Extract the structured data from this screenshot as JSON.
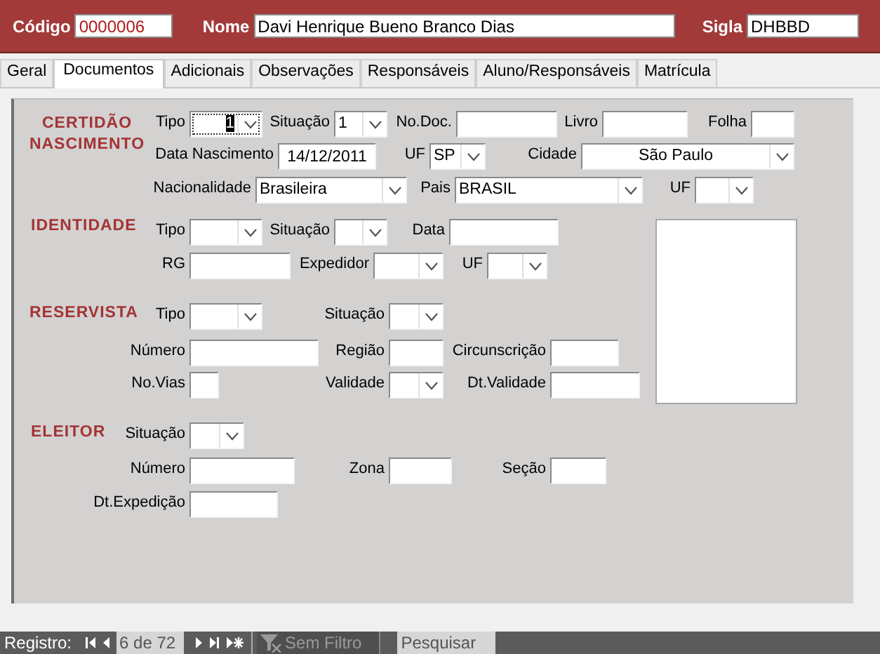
{
  "header": {
    "fields": [
      {
        "label": "Código",
        "value": "0000006"
      },
      {
        "label": "Nome",
        "value": "Davi Henrique Bueno Branco Dias"
      },
      {
        "label": "Sigla",
        "value": "DHBBD"
      }
    ]
  },
  "tabs": [
    {
      "label": "Geral",
      "selected": false
    },
    {
      "label": "Documentos",
      "selected": true
    },
    {
      "label": "Adicionais",
      "selected": false
    },
    {
      "label": "Observações",
      "selected": false
    },
    {
      "label": "Responsáveis",
      "selected": false
    },
    {
      "label": "Aluno/Responsáveis",
      "selected": false
    },
    {
      "label": "Matrícula",
      "selected": false
    }
  ],
  "sections": [
    {
      "title": "CERTIDÃO NASCIMENTO",
      "fields": [
        {
          "label": "Tipo",
          "kind": "combo",
          "value": "1",
          "focused": true
        },
        {
          "label": "Situação",
          "kind": "combo",
          "value": "1",
          "focused": false
        },
        {
          "label": "No.Doc.",
          "kind": "text",
          "focused": false
        },
        {
          "label": "Livro",
          "kind": "text",
          "focused": false
        },
        {
          "label": "Folha",
          "kind": "text",
          "focused": false
        },
        {
          "label": "Data Nascimento",
          "kind": "text",
          "value": "14/12/2011",
          "focused": false
        },
        {
          "label": "UF",
          "kind": "combo",
          "value": "SP",
          "focused": false
        },
        {
          "label": "Cidade",
          "kind": "combo",
          "value": "São Paulo",
          "focused": false
        },
        {
          "label": "Nacionalidade",
          "kind": "combo",
          "value": "Brasileira",
          "focused": false
        },
        {
          "label": "Pais",
          "kind": "combo",
          "value": "BRASIL",
          "focused": false
        },
        {
          "label": "UF",
          "kind": "combo",
          "focused": false
        }
      ]
    },
    {
      "title": "IDENTIDADE",
      "fields": [
        {
          "label": "Tipo",
          "kind": "combo",
          "focused": false
        },
        {
          "label": "Situação",
          "kind": "combo",
          "focused": false
        },
        {
          "label": "Data",
          "kind": "text",
          "focused": false
        },
        {
          "label": "RG",
          "kind": "text",
          "focused": false
        },
        {
          "label": "Expedidor",
          "kind": "combo",
          "focused": false
        },
        {
          "label": "UF",
          "kind": "combo",
          "focused": false
        }
      ]
    },
    {
      "title": "RESERVISTA",
      "fields": [
        {
          "label": "Tipo",
          "kind": "combo",
          "focused": false
        },
        {
          "label": "Situação",
          "kind": "combo",
          "focused": false
        },
        {
          "label": "Número",
          "kind": "text",
          "focused": false
        },
        {
          "label": "Região",
          "kind": "text",
          "focused": false
        },
        {
          "label": "Circunscrição",
          "kind": "text",
          "focused": false
        },
        {
          "label": "No.Vias",
          "kind": "text",
          "focused": false
        },
        {
          "label": "Validade",
          "kind": "combo",
          "focused": false
        },
        {
          "label": "Dt.Validade",
          "kind": "text",
          "focused": false
        }
      ]
    },
    {
      "title": "ELEITOR",
      "fields": [
        {
          "label": "Situação",
          "kind": "combo",
          "focused": false
        },
        {
          "label": "Número",
          "kind": "text",
          "focused": false
        },
        {
          "label": "Zona",
          "kind": "text",
          "focused": false
        },
        {
          "label": "Seção",
          "kind": "text",
          "focused": false
        },
        {
          "label": "Dt.Expedição",
          "kind": "text",
          "focused": false
        }
      ]
    }
  ],
  "photo": {
    "kind": "picture-frame"
  },
  "status_bar": {
    "label": "Registro:",
    "record": "6 de 72",
    "filter": {
      "label": "Sem Filtro",
      "disabled": true
    },
    "search": {
      "placeholder": "Pesquisar"
    }
  }
}
